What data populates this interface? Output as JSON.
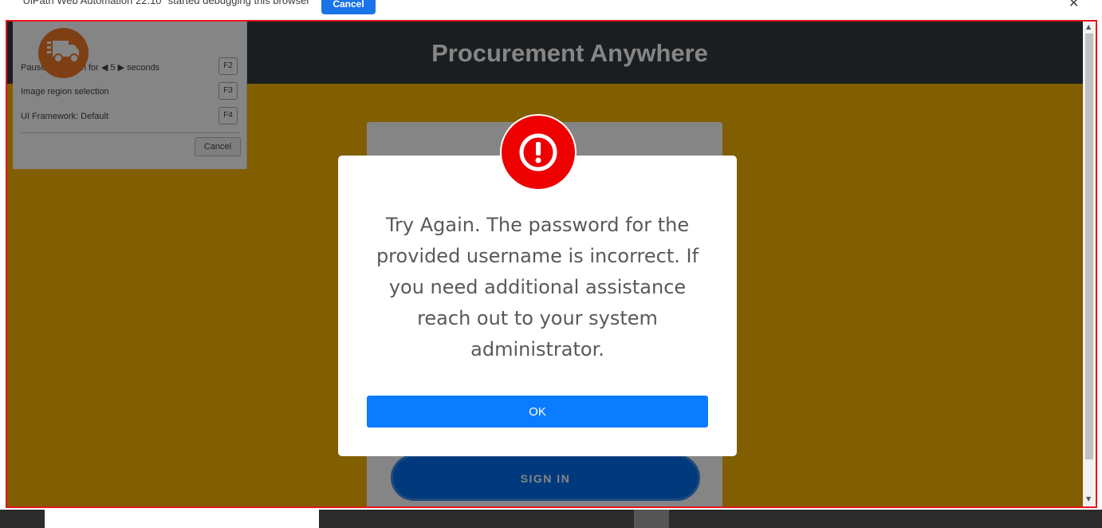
{
  "infobar": {
    "message": "\"UiPath Web Automation 22.10\" started debugging this browser",
    "cancel_label": "Cancel",
    "close_glyph": "✕"
  },
  "app": {
    "title": "Procurement Anywhere",
    "logo_icon": "truck-icon",
    "brand_color": "#f27a27",
    "header_color": "#343a40",
    "body_color": "#f8b500"
  },
  "helper_panel": {
    "rows": [
      {
        "label": "Pause extraction for ◀ 5 ▶ seconds",
        "key": "F2"
      },
      {
        "label": "Image region selection",
        "key": "F3"
      },
      {
        "label": "UI Framework: Default",
        "key": "F4"
      }
    ],
    "cancel_label": "Cancel"
  },
  "login": {
    "signin_label": "SIGN IN"
  },
  "dialog": {
    "icon": "exclamation-circle-icon",
    "icon_color": "#ee0000",
    "message": "Try Again. The password for the provided username is incorrect. If you need additional assistance reach out to your system administrator.",
    "ok_label": "OK",
    "ok_color": "#0a7cff"
  },
  "scrollbar": {
    "up_glyph": "▲",
    "down_glyph": "▼"
  }
}
